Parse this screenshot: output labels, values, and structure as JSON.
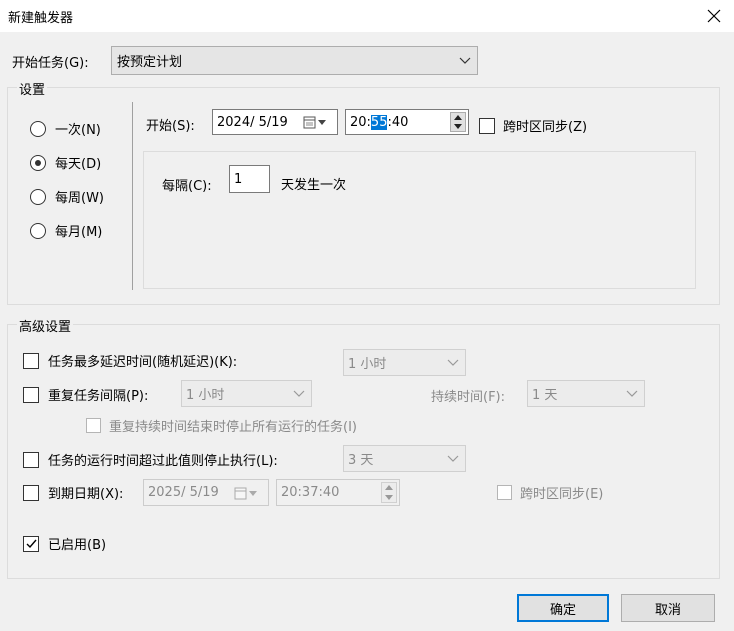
{
  "window": {
    "title": "新建触发器",
    "close_icon": "close-icon"
  },
  "begin_task": {
    "label": "开始任务(G):",
    "value": "按预定计划"
  },
  "settings": {
    "group_label": "设置",
    "radios": [
      {
        "label": "一次(N)",
        "checked": false
      },
      {
        "label": "每天(D)",
        "checked": true
      },
      {
        "label": "每周(W)",
        "checked": false
      },
      {
        "label": "每月(M)",
        "checked": false
      }
    ],
    "start_label": "开始(S):",
    "start_date": "2024/  5/19",
    "start_time_pre": "20:",
    "start_time_sel": "55",
    "start_time_post": ":40",
    "sync_label": "跨时区同步(Z)",
    "recur_label": "每隔(C):",
    "recur_value": "1",
    "recur_suffix": "天发生一次"
  },
  "advanced": {
    "group_label": "高级设置",
    "delay_label": "任务最多延迟时间(随机延迟)(K):",
    "delay_value": "1 小时",
    "repeat_label": "重复任务间隔(P):",
    "repeat_value": "1 小时",
    "duration_label": "持续时间(F):",
    "duration_value": "1 天",
    "stop_all_label": "重复持续时间结束时停止所有运行的任务(I)",
    "stop_if_label": "任务的运行时间超过此值则停止执行(L):",
    "stop_if_value": "3 天",
    "expire_label": "到期日期(X):",
    "expire_date": "2025/  5/19",
    "expire_time": "20:37:40",
    "expire_sync_label": "跨时区同步(E)",
    "enabled_label": "已启用(B)",
    "enabled_checked": true
  },
  "buttons": {
    "ok": "确定",
    "cancel": "取消"
  }
}
